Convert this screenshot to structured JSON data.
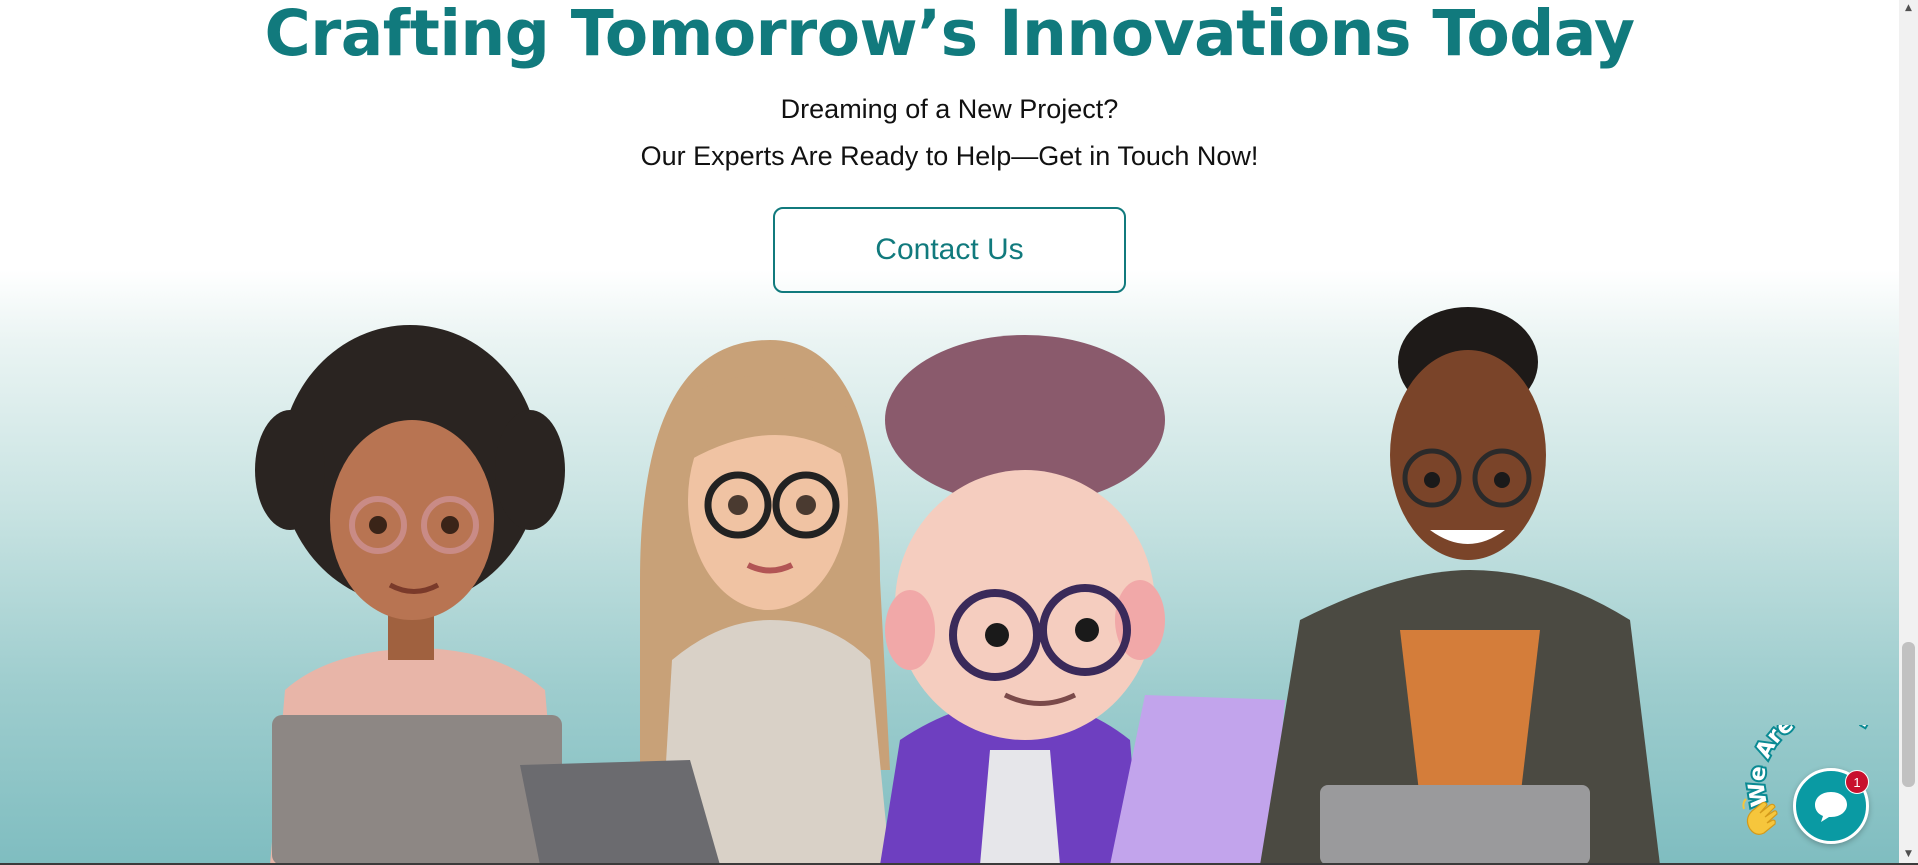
{
  "hero": {
    "headline": "Crafting Tomorrow’s Innovations Today",
    "subline_1": "Dreaming of a New Project?",
    "subline_2": "Our Experts Are Ready to Help—Get in Touch Now!",
    "contact_label": "Contact Us"
  },
  "illustration": {
    "alt": "team-of-four-cartoon-developers-with-laptops"
  },
  "chat_widget": {
    "tagline": "We Are Here!",
    "badge_count": "1",
    "icon": "chat-bubble-icon",
    "wave": "waving-hand-icon"
  },
  "colors": {
    "brand": "#117a7d",
    "chat": "#0a9aa3",
    "badge": "#c8102e"
  }
}
